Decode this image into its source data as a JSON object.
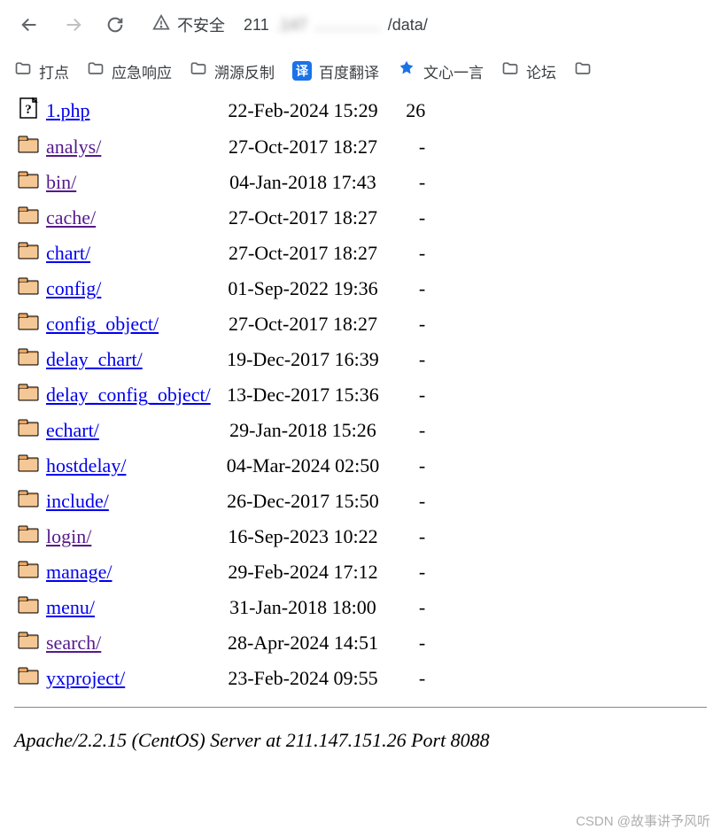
{
  "toolbar": {
    "insecure_label": "不安全",
    "url_prefix": "211",
    "url_blurred": ".147",
    "url_suffix": "/data/"
  },
  "bookmarks": [
    {
      "type": "folder",
      "label": "打点"
    },
    {
      "type": "folder",
      "label": "应急响应"
    },
    {
      "type": "folder",
      "label": "溯源反制"
    },
    {
      "type": "translate",
      "label": "百度翻译"
    },
    {
      "type": "wenxin",
      "label": "文心一言"
    },
    {
      "type": "folder",
      "label": "论坛"
    }
  ],
  "listing": [
    {
      "icon": "unknown",
      "name": "1.php",
      "visited": false,
      "date": "22-Feb-2024 15:29",
      "size": "26"
    },
    {
      "icon": "folder",
      "name": "analys/",
      "visited": true,
      "date": "27-Oct-2017 18:27",
      "size": "-"
    },
    {
      "icon": "folder",
      "name": "bin/",
      "visited": true,
      "date": "04-Jan-2018 17:43",
      "size": "-"
    },
    {
      "icon": "folder",
      "name": "cache/",
      "visited": true,
      "date": "27-Oct-2017 18:27",
      "size": "-"
    },
    {
      "icon": "folder",
      "name": "chart/",
      "visited": false,
      "date": "27-Oct-2017 18:27",
      "size": "-"
    },
    {
      "icon": "folder",
      "name": "config/",
      "visited": false,
      "date": "01-Sep-2022 19:36",
      "size": "-"
    },
    {
      "icon": "folder",
      "name": "config_object/",
      "visited": false,
      "date": "27-Oct-2017 18:27",
      "size": "-"
    },
    {
      "icon": "folder",
      "name": "delay_chart/",
      "visited": false,
      "date": "19-Dec-2017 16:39",
      "size": "-"
    },
    {
      "icon": "folder",
      "name": "delay_config_object/",
      "visited": false,
      "date": "13-Dec-2017 15:36",
      "size": "-"
    },
    {
      "icon": "folder",
      "name": "echart/",
      "visited": false,
      "date": "29-Jan-2018 15:26",
      "size": "-"
    },
    {
      "icon": "folder",
      "name": "hostdelay/",
      "visited": false,
      "date": "04-Mar-2024 02:50",
      "size": "-"
    },
    {
      "icon": "folder",
      "name": "include/",
      "visited": false,
      "date": "26-Dec-2017 15:50",
      "size": "-"
    },
    {
      "icon": "folder",
      "name": "login/",
      "visited": true,
      "date": "16-Sep-2023 10:22",
      "size": "-"
    },
    {
      "icon": "folder",
      "name": "manage/",
      "visited": false,
      "date": "29-Feb-2024 17:12",
      "size": "-"
    },
    {
      "icon": "folder",
      "name": "menu/",
      "visited": false,
      "date": "31-Jan-2018 18:00",
      "size": "-"
    },
    {
      "icon": "folder",
      "name": "search/",
      "visited": true,
      "date": "28-Apr-2024 14:51",
      "size": "-"
    },
    {
      "icon": "folder",
      "name": "yxproject/",
      "visited": false,
      "date": "23-Feb-2024 09:55",
      "size": "-"
    }
  ],
  "footer": "Apache/2.2.15 (CentOS) Server at 211.147.151.26 Port 8088",
  "watermark": "CSDN @故事讲予风听"
}
